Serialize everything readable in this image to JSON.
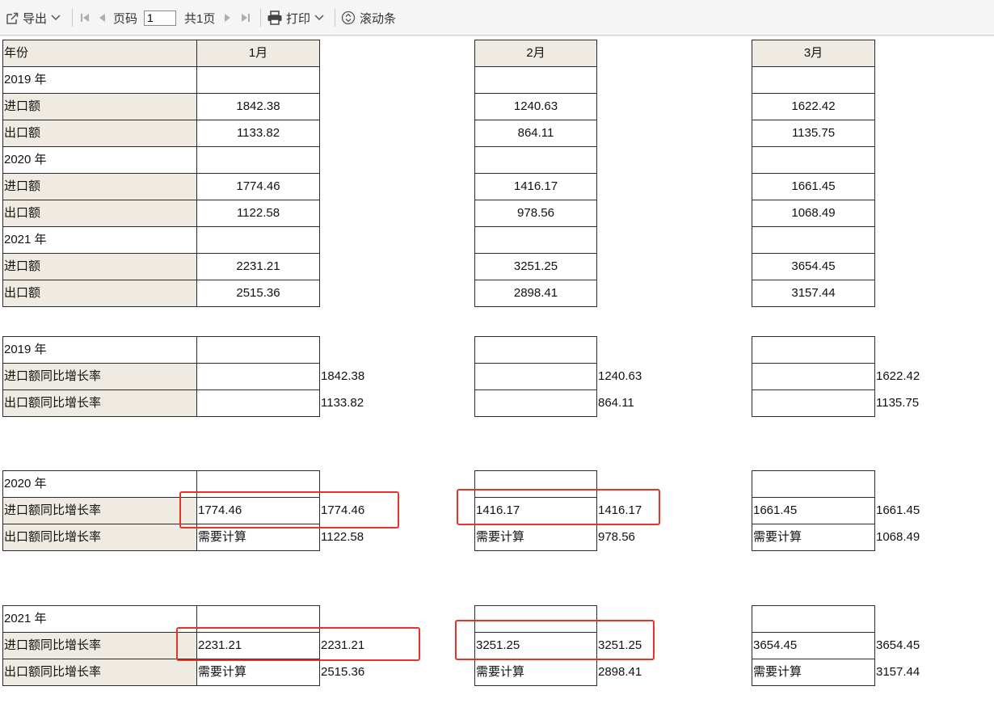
{
  "toolbar": {
    "export_label": "导出",
    "page_label": "页码",
    "page_value": "1",
    "total_label": "共1页",
    "print_label": "打印",
    "scroll_label": "滚动条"
  },
  "table1": {
    "header": {
      "label": "年份",
      "months": [
        "1月",
        "2月",
        "3月"
      ]
    },
    "rows": [
      {
        "label": "2019 年",
        "values": [
          "",
          "",
          ""
        ]
      },
      {
        "label": "进口额",
        "values": [
          "1842.38",
          "1240.63",
          "1622.42"
        ]
      },
      {
        "label": "出口额",
        "values": [
          "1133.82",
          "864.11",
          "1135.75"
        ]
      },
      {
        "label": "2020 年",
        "values": [
          "",
          "",
          ""
        ]
      },
      {
        "label": "进口额",
        "values": [
          "1774.46",
          "1416.17",
          "1661.45"
        ]
      },
      {
        "label": "出口额",
        "values": [
          "1122.58",
          "978.56",
          "1068.49"
        ]
      },
      {
        "label": "2021 年",
        "values": [
          "",
          "",
          ""
        ]
      },
      {
        "label": "进口额",
        "values": [
          "2231.21",
          "3251.25",
          "3654.45"
        ]
      },
      {
        "label": "出口额",
        "values": [
          "2515.36",
          "2898.41",
          "3157.44"
        ]
      }
    ]
  },
  "growth_blocks": [
    {
      "year_label": "2019 年",
      "rows": [
        {
          "label": "进口额同比增长率",
          "cells": [
            "",
            "",
            ""
          ],
          "side": [
            "1842.38",
            "1240.63",
            "1622.42"
          ]
        },
        {
          "label": "出口额同比增长率",
          "cells": [
            "",
            "",
            ""
          ],
          "side": [
            "1133.82",
            "864.11",
            "1135.75"
          ]
        }
      ]
    },
    {
      "year_label": "2020 年",
      "rows": [
        {
          "label": "进口额同比增长率",
          "cells": [
            "1774.46",
            "1416.17",
            "1661.45"
          ],
          "side": [
            "1774.46",
            "1416.17",
            "1661.45"
          ]
        },
        {
          "label": "出口额同比增长率",
          "cells": [
            "需要计算",
            "需要计算",
            "需要计算"
          ],
          "side": [
            "1122.58",
            "978.56",
            "1068.49"
          ]
        }
      ]
    },
    {
      "year_label": "2021 年",
      "rows": [
        {
          "label": "进口额同比增长率",
          "cells": [
            "2231.21",
            "3251.25",
            "3654.45"
          ],
          "side": [
            "2231.21",
            "3251.25",
            "3654.45"
          ]
        },
        {
          "label": "出口额同比增长率",
          "cells": [
            "需要计算",
            "需要计算",
            "需要计算"
          ],
          "side": [
            "2515.36",
            "2898.41",
            "3157.44"
          ]
        }
      ]
    }
  ],
  "colors": {
    "header_bg": "#efebe2",
    "highlight": "#e8332b",
    "toolbar_bg": "#f5f5f5"
  }
}
